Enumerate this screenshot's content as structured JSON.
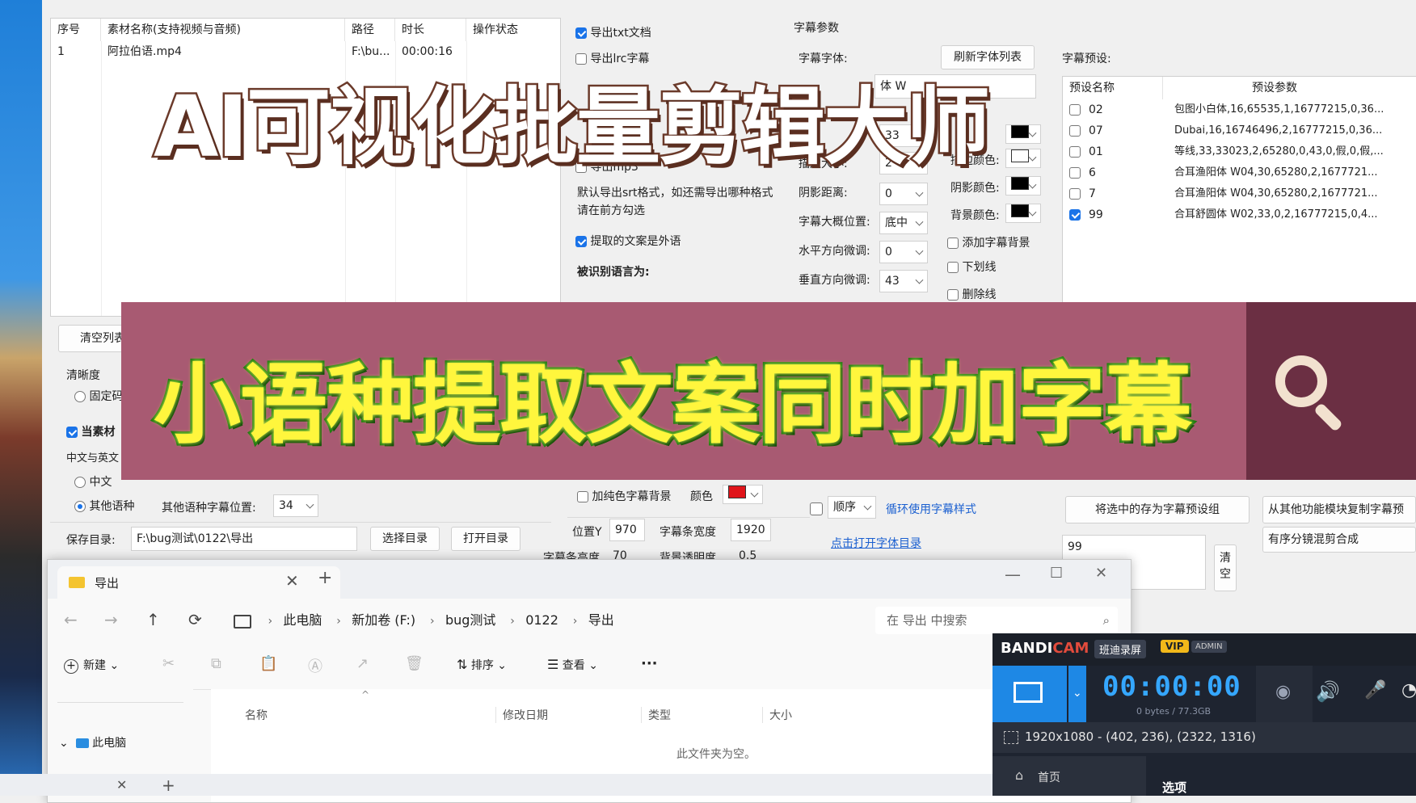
{
  "material_table": {
    "headers": [
      "序号",
      "素材名称(支持视频与音频)",
      "路径",
      "时长",
      "操作状态"
    ],
    "rows": [
      [
        "1",
        "阿拉伯语.mp4",
        "F:\\bu...",
        "00:00:16",
        ""
      ]
    ]
  },
  "export_options": {
    "export_txt": {
      "label": "导出txt文档",
      "checked": true
    },
    "export_lrc": {
      "label": "导出lrc字幕",
      "checked": false
    },
    "export_mp3": {
      "label": "导出mp3",
      "checked": false
    },
    "hint": "默认导出srt格式，如还需导出哪种格式请在前方勾选",
    "foreign": {
      "label": "提取的文案是外语",
      "checked": true
    },
    "lang_label": "被识别语言为:"
  },
  "subtitle_params": {
    "section_title": "字幕参数",
    "font_label": "字幕字体:",
    "refresh_button": "刷新字体列表",
    "font_value_partial": "体 W",
    "size_partial": "33",
    "outline_label": "描边大小:",
    "outline_value": "2",
    "outline_color_label": "描边颜色:",
    "shadow_dist_label": "阴影距离:",
    "shadow_dist_value": "0",
    "shadow_color_label": "阴影颜色:",
    "position_label": "字幕大概位置:",
    "position_value": "底中",
    "bg_color_label": "背景颜色:",
    "h_adjust_label": "水平方向微调:",
    "h_adjust_value": "0",
    "v_adjust_label": "垂直方向微调:",
    "v_adjust_value": "43",
    "add_bg": {
      "label": "添加字幕背景",
      "checked": false
    },
    "underline": {
      "label": "下划线",
      "checked": false
    },
    "strikethrough": {
      "label": "删除线",
      "checked": false
    }
  },
  "presets": {
    "title": "字幕预设:",
    "headers": [
      "预设名称",
      "预设参数"
    ],
    "rows": [
      {
        "name": "02",
        "params": "包图小白体,16,65535,1,16777215,0,36...",
        "checked": false
      },
      {
        "name": "07",
        "params": "Dubai,16,16746496,2,16777215,0,36...",
        "checked": false
      },
      {
        "name": "01",
        "params": "等线,33,33023,2,65280,0,43,0,假,0,假,...",
        "checked": false
      },
      {
        "name": "6",
        "params": "合耳渔阳体 W04,30,65280,2,1677721...",
        "checked": false
      },
      {
        "name": "7",
        "params": "合耳渔阳体 W04,30,65280,2,1677721...",
        "checked": false
      },
      {
        "name": "99",
        "params": "合耳舒圆体 W02,33,0,2,16777215,0,4...",
        "checked": true
      }
    ]
  },
  "left_panel": {
    "clear_list": "清空列表",
    "clarity_label": "清晰度",
    "fixed_partial": "固定码",
    "current_partial": "当素材",
    "cn_en_partial": "中文与英文",
    "cn_partial": "中文",
    "other_lang": "其他语种",
    "other_pos_label": "其他语种字幕位置:",
    "other_pos_value": "34",
    "save_dir_label": "保存目录:",
    "save_dir_value": "F:\\bug测试\\0122\\导出",
    "choose_dir": "选择目录",
    "open_dir": "打开目录"
  },
  "mid_lower": {
    "solid_bg_partial": "加纯色字幕背景",
    "color_label": "颜色",
    "pos_y_label": "位置Y",
    "pos_y_value": "970",
    "bar_width_label": "字幕条宽度",
    "bar_width_value": "1920",
    "bar_height_partial": "字幕条高度",
    "bar_height_value": "70",
    "bg_opacity_partial": "背景透明度",
    "bg_opacity_value": "0.5",
    "order_value": "顺序",
    "cycle_link": "循环使用字幕样式",
    "open_font_dir": "点击打开字体目录"
  },
  "right_lower": {
    "save_preset": "将选中的存为字幕预设组",
    "copy_from": "从其他功能模块复制字幕预",
    "preset_input": "99",
    "clear_btn": "清空",
    "ordered_merge": "有序分镜混剪合成"
  },
  "explorer": {
    "tab_title": "导出",
    "crumbs": [
      "此电脑",
      "新加卷 (F:)",
      "bug测试",
      "0122",
      "导出"
    ],
    "search_placeholder": "在 导出 中搜索",
    "new_label": "新建",
    "sort_label": "排序",
    "view_label": "查看",
    "more_label": "···",
    "col_name": "名称",
    "col_date": "修改日期",
    "col_type": "类型",
    "col_size": "大小",
    "nav_pc": "此电脑",
    "empty_msg": "此文件夹为空。"
  },
  "bandicam": {
    "brand_a": "BANDI",
    "brand_b": "CAM",
    "brand_cn": "班迪录屏",
    "vip": "VIP",
    "admin": "ADMIN",
    "timer": "00:00:00",
    "storage": "0 bytes / 77.3GB",
    "region": "1920x1080 - (402, 236), (2322, 1316)",
    "home": "首页",
    "options": "选项"
  },
  "overlay": {
    "title_top": "AI可视化批量剪辑大师",
    "title_banner": "小语种提取文案同时加字幕"
  },
  "colors": {
    "accent": "#1a73e8",
    "banner": "#a85a72",
    "banner_dark": "#6b2f43",
    "title_yellow": "#fff63d",
    "title_green": "#1c7a10",
    "red_swatch": "#e0141a"
  }
}
